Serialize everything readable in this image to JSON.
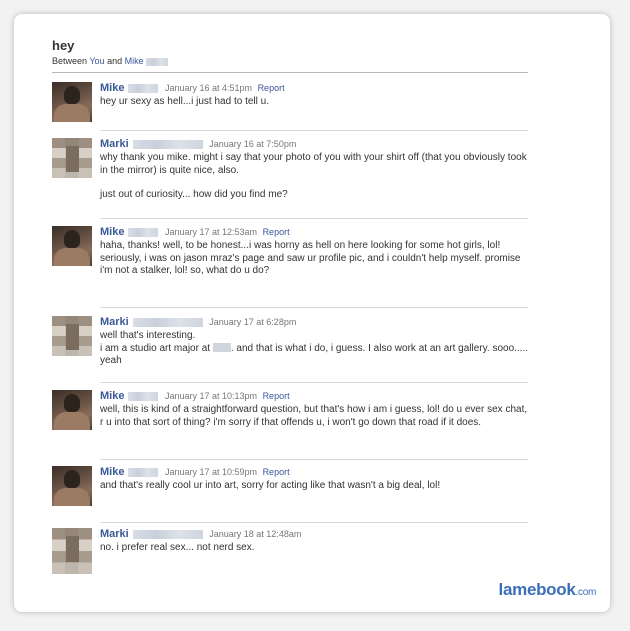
{
  "thread": {
    "title": "hey",
    "between_prefix": "Between",
    "participant_you": "You",
    "and_text": "and",
    "participant_other": "Mike"
  },
  "messages": [
    {
      "sender": "Mike",
      "timestamp": "January 16 at 4:51pm",
      "report": "Report",
      "paragraphs": [
        "hey ur sexy as hell...i just had to tell u."
      ]
    },
    {
      "sender": "Marki",
      "timestamp": "January 16 at 7:50pm",
      "report": "",
      "paragraphs": [
        "why thank you mike. might i say that your photo of you with your shirt off (that you obviously took in the mirror) is quite nice, also.",
        "just out of curiosity... how did you find me?"
      ]
    },
    {
      "sender": "Mike",
      "timestamp": "January 17 at 12:53am",
      "report": "Report",
      "paragraphs": [
        "haha, thanks! well, to be honest...i was horny as hell on here looking for some hot girls, lol! seriously, i was on jason mraz's page and saw ur profile pic, and i couldn't help myself. promise i'm not a stalker, lol! so, what do u do?"
      ]
    },
    {
      "sender": "Marki",
      "timestamp": "January 17 at 6:28pm",
      "report": "",
      "line1": "well that's interesting.",
      "line2_before": "i am a studio art major at",
      "line2_after": ". and that is what i do, i guess. I also work at an art gallery. sooo..... yeah"
    },
    {
      "sender": "Mike",
      "timestamp": "January 17 at 10:13pm",
      "report": "Report",
      "paragraphs": [
        "well, this is kind of a straightforward question, but that's how i am i guess, lol! do u ever sex chat, r u into that sort of thing? i'm sorry if that offends u, i won't go down that road if it does."
      ]
    },
    {
      "sender": "Mike",
      "timestamp": "January 17 at 10:59pm",
      "report": "Report",
      "paragraphs": [
        "and that's really cool ur into art, sorry for acting like that wasn't a big deal, lol!"
      ]
    },
    {
      "sender": "Marki",
      "timestamp": "January 18 at 12:48am",
      "report": "",
      "paragraphs": [
        "no. i prefer real sex... not nerd sex."
      ]
    }
  ],
  "watermark": {
    "brand": "lamebook",
    "domain": ".com"
  },
  "colors": {
    "link": "#3b5998",
    "logo": "#3b6fb6"
  }
}
